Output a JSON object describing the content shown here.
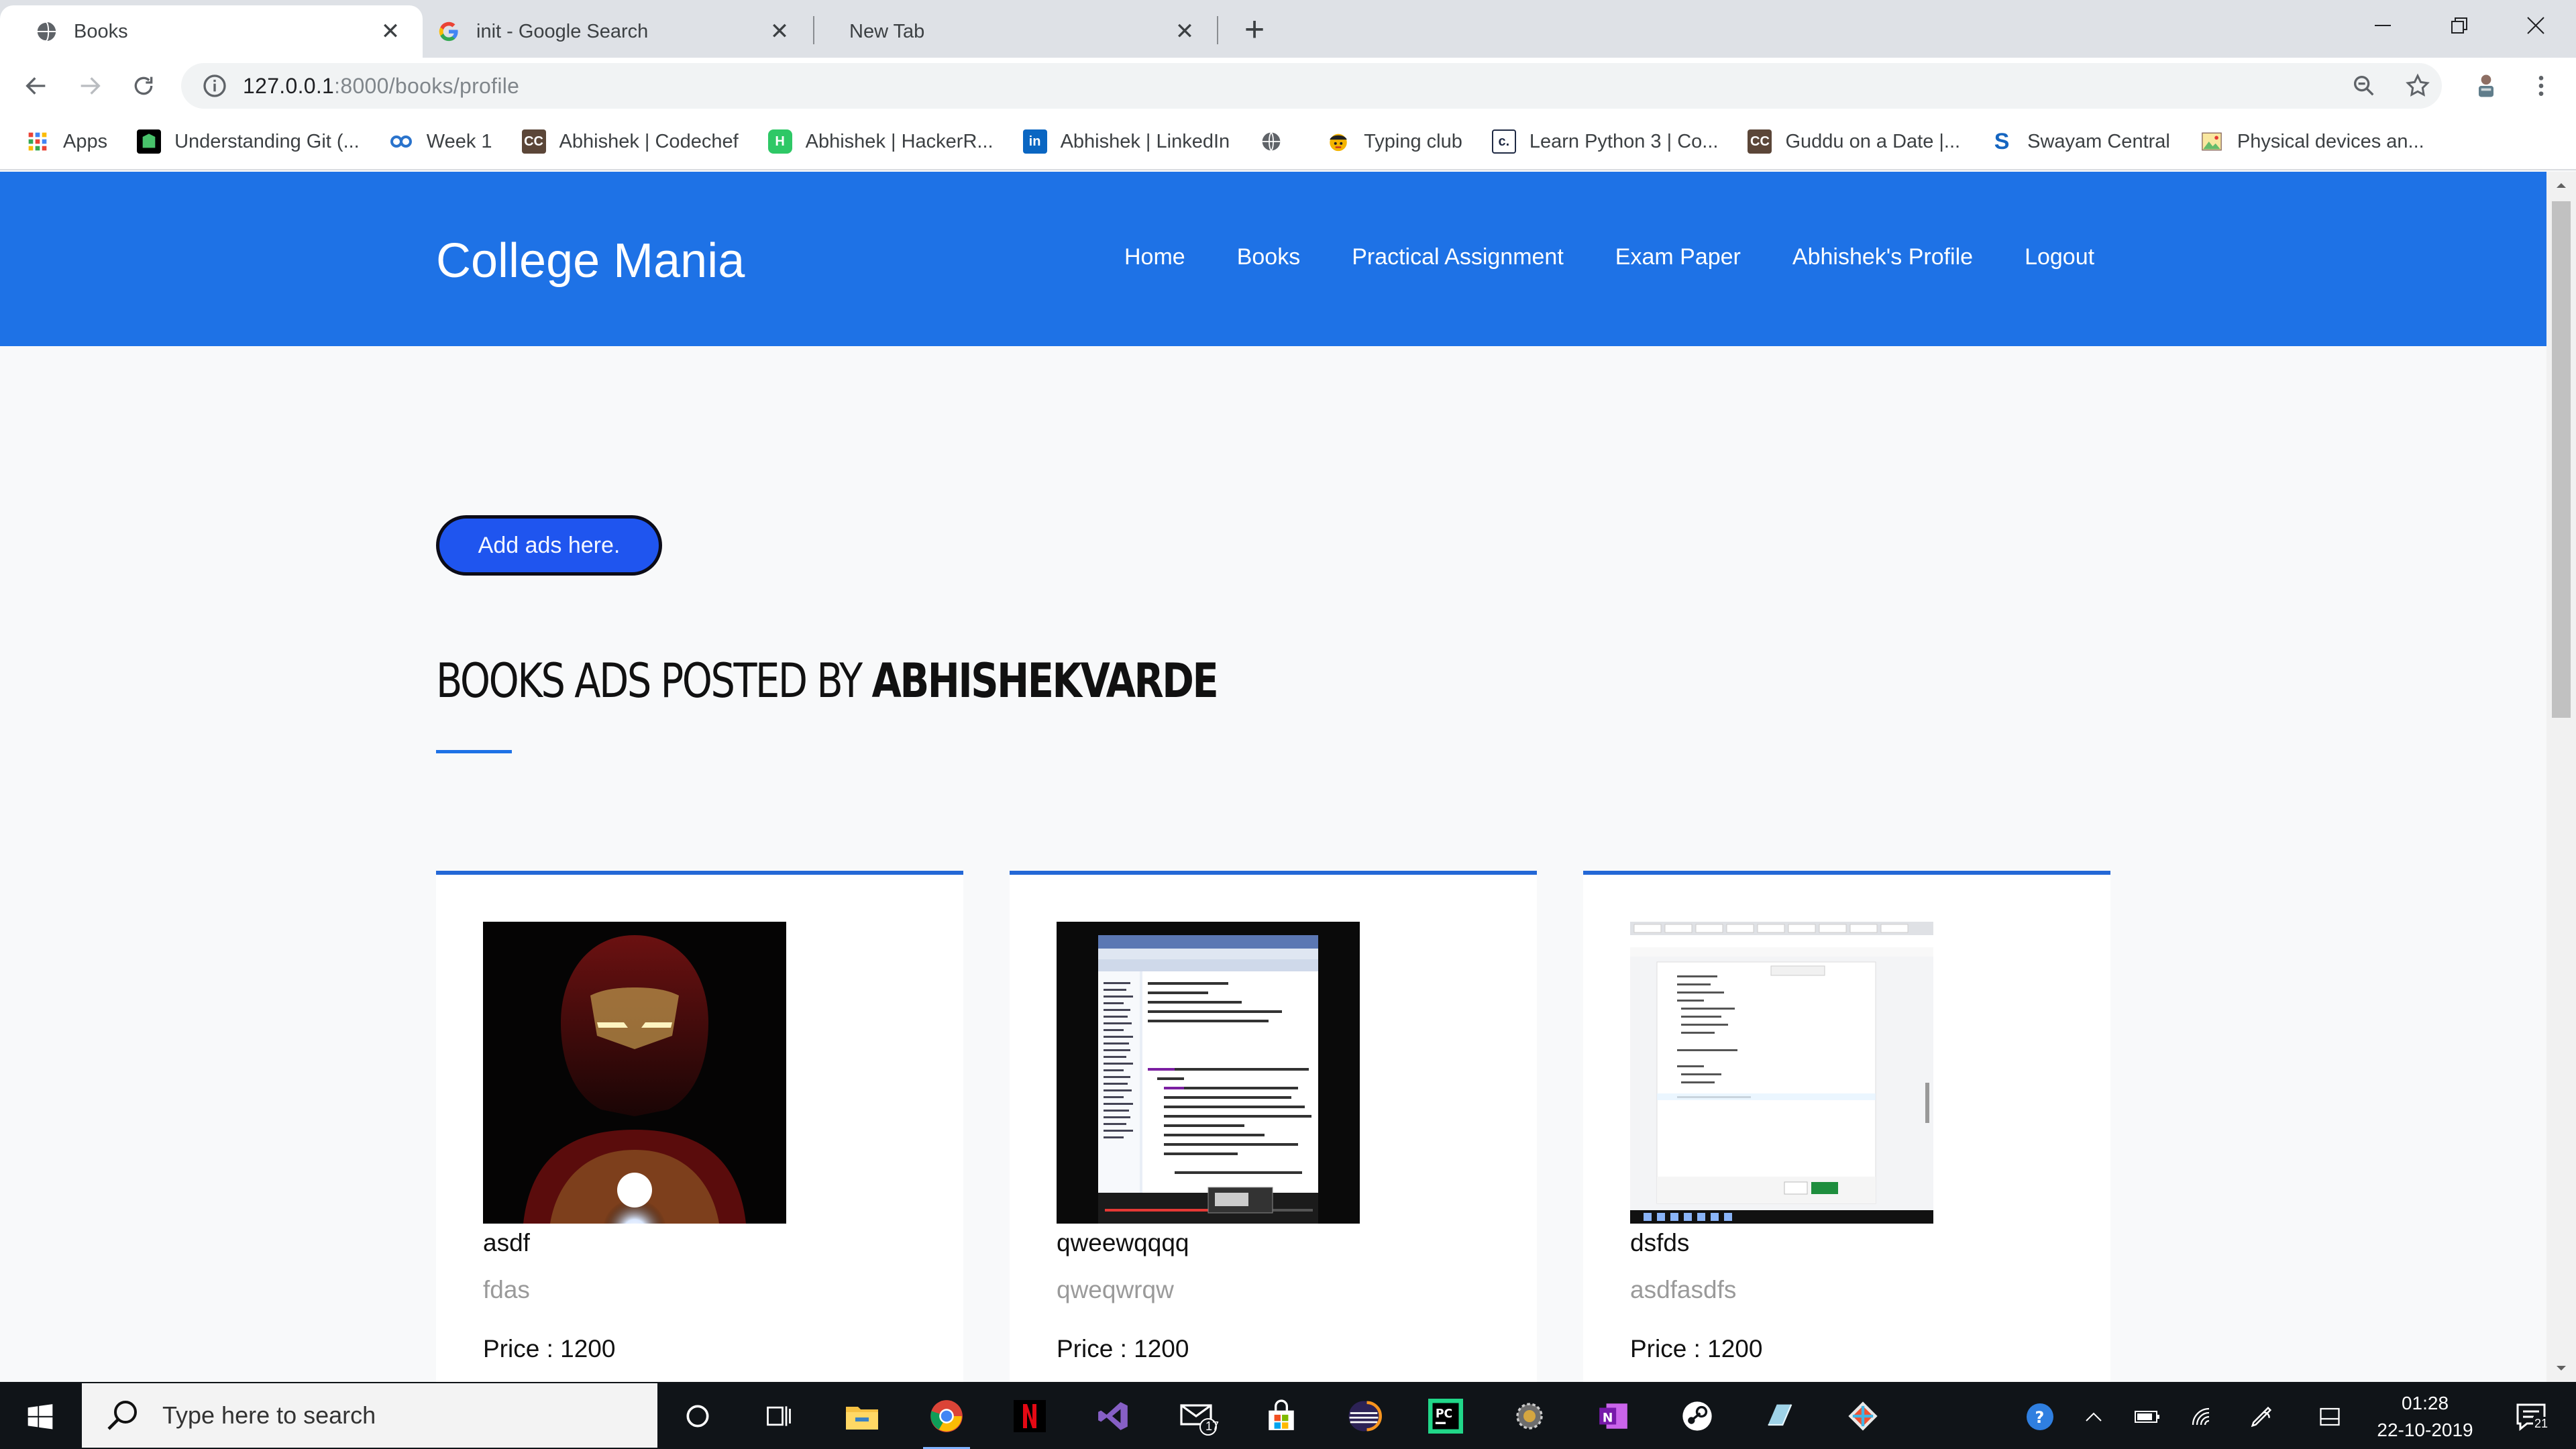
{
  "browser": {
    "tabs": [
      {
        "title": "Books",
        "active": true
      },
      {
        "title": "init - Google Search",
        "active": false
      },
      {
        "title": "New Tab",
        "active": false
      }
    ],
    "url_host": "127.0.0.1",
    "url_path": ":8000/books/profile",
    "bookmarks": [
      {
        "label": "Apps",
        "icon": "apps-grid-icon"
      },
      {
        "label": "Understanding Git (...",
        "icon": "git-tower-icon"
      },
      {
        "label": "Week 1",
        "icon": "coursera-icon"
      },
      {
        "label": "Abhishek | Codechef",
        "icon": "codechef-icon"
      },
      {
        "label": "Abhishek | HackerR...",
        "icon": "hackerrank-icon"
      },
      {
        "label": "Abhishek | LinkedIn",
        "icon": "linkedin-icon"
      },
      {
        "label": "",
        "icon": "globe-icon"
      },
      {
        "label": "Typing club",
        "icon": "typing-club-icon"
      },
      {
        "label": "Learn Python 3 | Co...",
        "icon": "codecademy-icon"
      },
      {
        "label": "Guddu on a Date |...",
        "icon": "codechef-icon"
      },
      {
        "label": "Swayam Central",
        "icon": "swayam-icon"
      },
      {
        "label": "Physical devices an...",
        "icon": "image-icon"
      }
    ]
  },
  "site": {
    "brand": "College Mania",
    "nav": [
      "Home",
      "Books",
      "Practical Assignment",
      "Exam Paper",
      "Abhishek's Profile",
      "Logout"
    ],
    "add_button": "Add ads here.",
    "heading_prefix": "BOOKS ADS POSTED BY ",
    "heading_user": "ABHISHEKVARDE",
    "accent": "#1e72e6",
    "cards": [
      {
        "title": "asdf",
        "subtitle": "fdas",
        "price": "Price : 1200",
        "image": "iron-man-image"
      },
      {
        "title": "qweewqqqq",
        "subtitle": "qweqwrqw",
        "price": "Price : 1200",
        "image": "ide-screenshot-image"
      },
      {
        "title": "dsfds",
        "subtitle": "asdfasdfs",
        "price": "Price : 1200",
        "image": "editor-screenshot-image"
      }
    ]
  },
  "taskbar": {
    "search_placeholder": "Type here to search",
    "time": "01:28",
    "date": "22-10-2019",
    "mail_badge": "17",
    "notification_count": "21"
  }
}
